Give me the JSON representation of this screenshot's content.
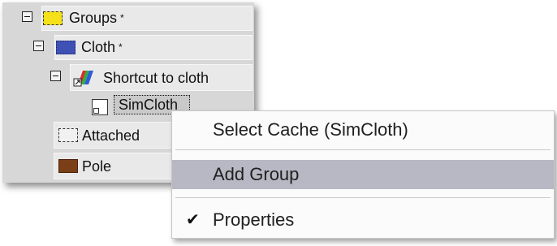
{
  "tree": {
    "items": [
      {
        "label": "Groups",
        "marker": "*",
        "swatch": "groups"
      },
      {
        "label": "Cloth",
        "marker": "*",
        "swatch": "cloth"
      },
      {
        "label": "Shortcut to cloth"
      },
      {
        "label": "SimCloth"
      },
      {
        "label": "Attached",
        "swatch": "attached"
      },
      {
        "label": "Pole",
        "swatch": "pole"
      }
    ]
  },
  "context_menu": {
    "items": [
      {
        "label": "Select Cache (SimCloth)",
        "checked": false
      },
      {
        "label": "Add Group",
        "checked": false,
        "highlighted": true
      },
      {
        "label": "Properties",
        "checked": true,
        "check_symbol": "✔"
      }
    ]
  },
  "colors": {
    "panel_bg": "#d7d7d7",
    "row_bg": "#e9e9e9",
    "groups_swatch": "#f5e11a",
    "cloth_swatch": "#3f51b5",
    "pole_swatch": "#7a3f16",
    "menu_highlight": "#b8b8c4"
  },
  "icons": {
    "expander": "minus-box-icon",
    "shortcut": "shortcut-cloth-icon",
    "document": "document-shortcut-icon",
    "check": "checkmark-icon"
  }
}
